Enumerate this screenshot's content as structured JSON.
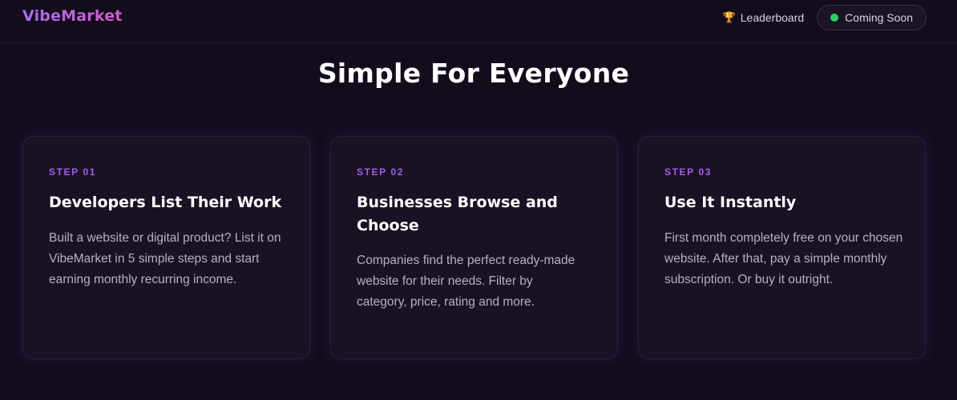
{
  "nav": {
    "logo": "VibeMarket",
    "leaderboard_label": "Leaderboard",
    "leaderboard_icon": "trophy-icon",
    "status_label": "Coming Soon",
    "status_color": "#2ed06a"
  },
  "section": {
    "title": "Simple For Everyone"
  },
  "steps": [
    {
      "step": "STEP 01",
      "heading": "Developers List Their Work",
      "description": "Built a website or digital product? List it on VibeMarket in 5 simple steps and start earning monthly recurring income."
    },
    {
      "step": "STEP 02",
      "heading": "Businesses Browse and Choose",
      "description": "Companies find the perfect ready-made website for their needs. Filter by category, price, rating and more."
    },
    {
      "step": "STEP 03",
      "heading": "Use It Instantly",
      "description": "First month completely free on your chosen website. After that, pay a simple monthly subscription. Or buy it outright."
    }
  ],
  "colors": {
    "background": "#140c1c",
    "accent": "#a35ee9",
    "card": "#1a1224"
  }
}
